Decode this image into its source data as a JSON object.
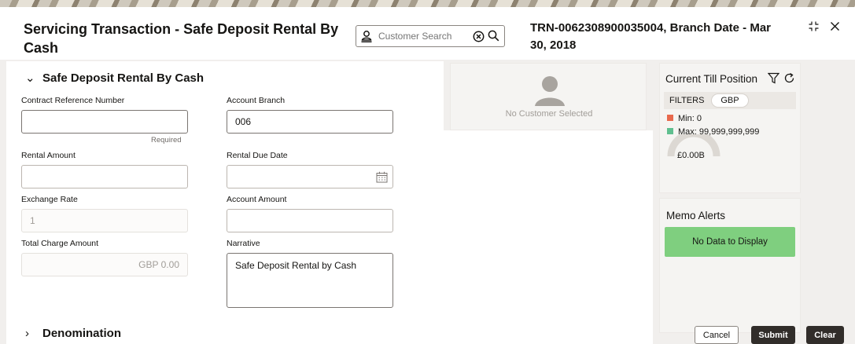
{
  "header": {
    "title": "Servicing Transaction - Safe Deposit Rental By Cash",
    "search_placeholder": "Customer Search",
    "transaction_info": "TRN-0062308900035004, Branch Date - Mar 30, 2018"
  },
  "sections": {
    "main": "Safe Deposit Rental By Cash",
    "denomination": "Denomination"
  },
  "form": {
    "contract_ref": {
      "label": "Contract Reference Number",
      "value": "",
      "hint": "Required"
    },
    "account_branch": {
      "label": "Account Branch",
      "value": "006"
    },
    "rental_amount": {
      "label": "Rental Amount",
      "value": ""
    },
    "rental_due_date": {
      "label": "Rental Due Date",
      "value": ""
    },
    "exchange_rate": {
      "label": "Exchange Rate",
      "value": "1"
    },
    "account_amount": {
      "label": "Account Amount",
      "value": ""
    },
    "total_charge": {
      "label": "Total Charge Amount",
      "value": "GBP 0.00"
    },
    "narrative": {
      "label": "Narrative",
      "value": "Safe Deposit Rental by Cash"
    }
  },
  "customer_panel": {
    "empty_text": "No Customer Selected"
  },
  "till": {
    "title": "Current Till Position",
    "filters_label": "FILTERS",
    "currency_chip": "GBP",
    "min_label": "Min: 0",
    "max_label": "Max: 99,999,999,999",
    "amount": "£0.00B",
    "min_color": "#e8694d",
    "max_color": "#5fbf8f"
  },
  "memo": {
    "title": "Memo Alerts",
    "empty_text": "No Data to Display"
  },
  "actions": {
    "cancel": "Cancel",
    "submit": "Submit",
    "clear": "Clear"
  }
}
